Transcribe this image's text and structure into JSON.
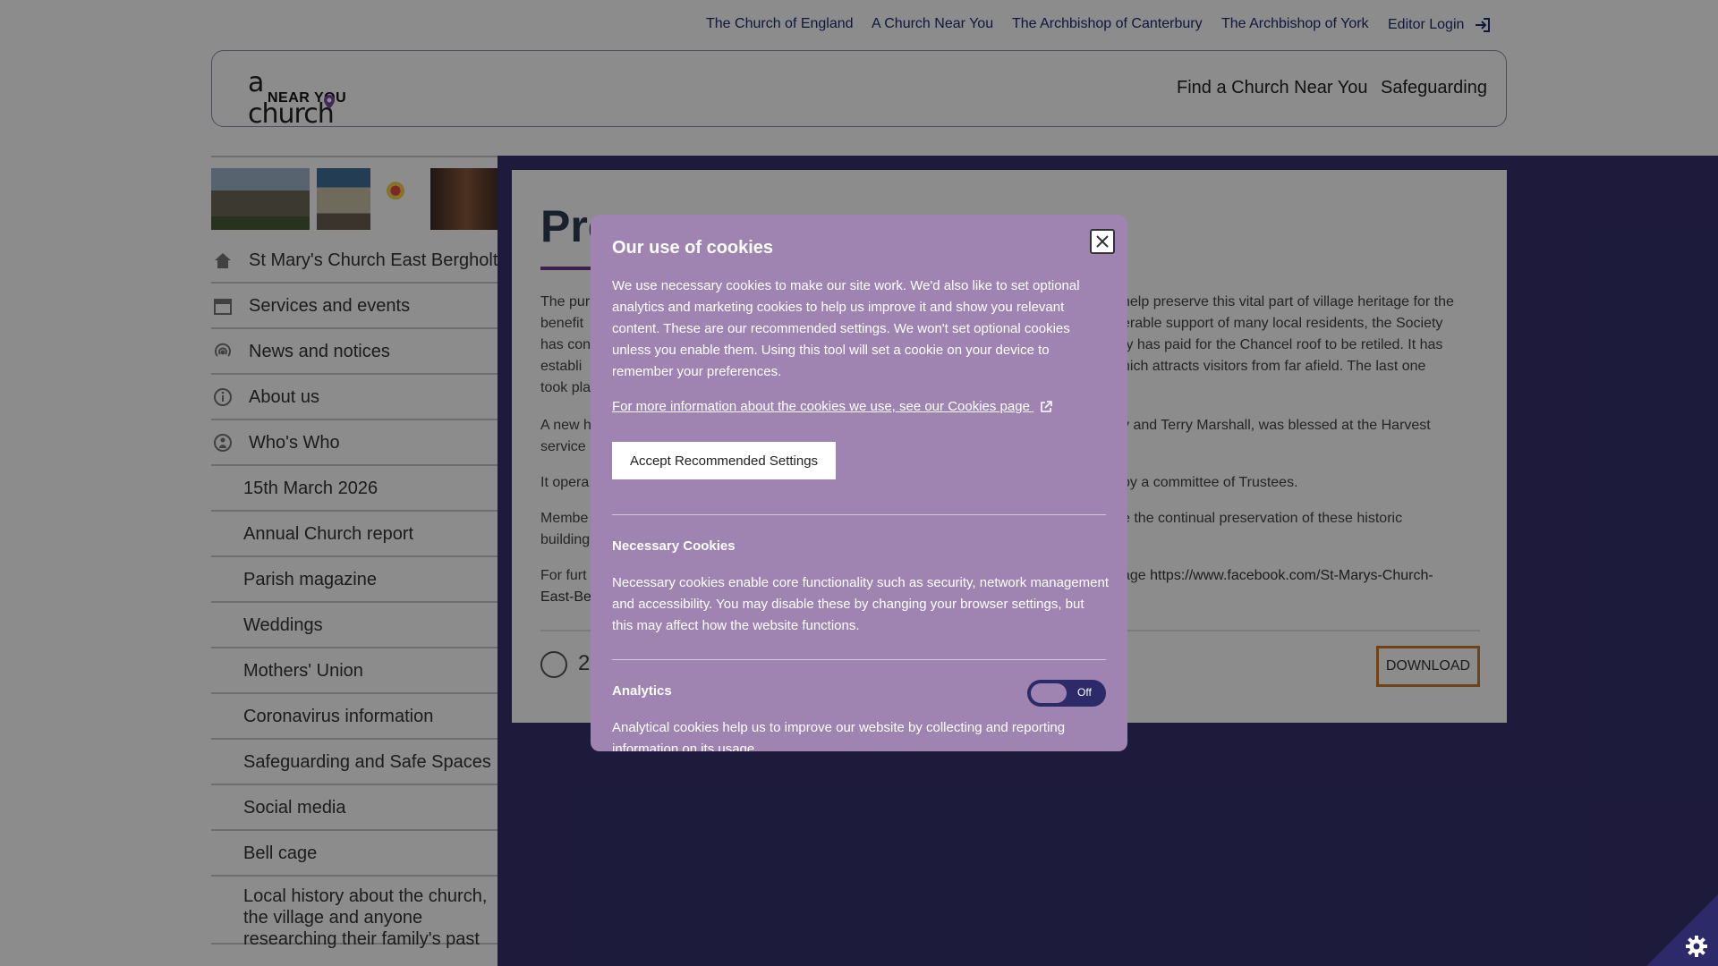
{
  "utility_nav": {
    "links": [
      "The Church of England",
      "A Church Near You",
      "The Archbishop of Canterbury",
      "The Archbishop of York"
    ],
    "editor_login": "Editor Login"
  },
  "header": {
    "logo_line1": "a church",
    "logo_line2": "NEAR YOU",
    "nav": [
      "Find a Church Near You",
      "Safeguarding"
    ]
  },
  "sidebar": {
    "items": [
      {
        "label": "St Mary's Church East Bergholt",
        "icon": "home-icon"
      },
      {
        "label": "Services and events",
        "icon": "calendar-icon"
      },
      {
        "label": "News and notices",
        "icon": "broadcast-icon"
      },
      {
        "label": "About us",
        "icon": "info-icon"
      },
      {
        "label": "Who's Who",
        "icon": "person-icon"
      }
    ],
    "sub_items": [
      "15th March 2026",
      "Annual Church report",
      "Parish magazine",
      "Weddings",
      "Mothers' Union",
      "Coronavirus information",
      "Safeguarding and Safe Spaces",
      "Social media",
      "Bell cage",
      "Local history about the church, the village and anyone researching their family's past"
    ]
  },
  "content": {
    "title_visible": "Pre",
    "p1_left": "The pur",
    "p1_right": "help preserve this vital part of village heritage for the",
    "p1_l2_left": "benefit",
    "p1_l2_right": "erable support of many local residents, the Society",
    "p1_l3_left": "has con",
    "p1_l3_right": "ty has paid for the Chancel roof to be retiled.  It has",
    "p1_l4_left": "establi",
    "p1_l4_right": "hich attracts visitors from far afield.  The last one",
    "p1_l5_left": "took pla",
    "p2_left": "A new h",
    "p2_right": "y and Terry Marshall, was blessed at the Harvest",
    "p2_l2_left": "service",
    "p3_left": "It opera",
    "p3_right": "by a committee of Trustees.",
    "p4_left": "Membe",
    "p4_right": "e the continual preservation of these historic",
    "p4_l2_left": "building",
    "p5_left": "For furt",
    "p5_right_prefix": "age ",
    "p5_link": "https://www.facebook.com/St-Marys-Church-",
    "p5_link_l2": "East-Be",
    "download_prefix": "2",
    "download_label": "DOWNLOAD"
  },
  "cookie_dialog": {
    "title": "Our use of cookies",
    "intro": "We use necessary cookies to make our site work. We'd also like to set optional analytics and marketing cookies to help us improve it and show you relevant content. These are our recommended settings. We won't set optional cookies unless you enable them. Using this tool will set a cookie on your device to remember your preferences.",
    "more_link": "For more information about the cookies we use, see our Cookies page",
    "accept_label": "Accept Recommended Settings",
    "necessary_title": "Necessary Cookies",
    "necessary_text": "Necessary cookies enable core functionality such as security, network management and accessibility. You may disable these by changing your browser settings, but this may affect how the website functions.",
    "analytics_title": "Analytics",
    "analytics_state": "Off",
    "analytics_text": "Analytical cookies help us to improve our website by collecting and reporting information on its usage."
  },
  "colors": {
    "brand_dark": "#35316e",
    "dialog_bg": "#9f84b2",
    "download_border": "#c77b2b",
    "link": "#1e2a6e"
  }
}
